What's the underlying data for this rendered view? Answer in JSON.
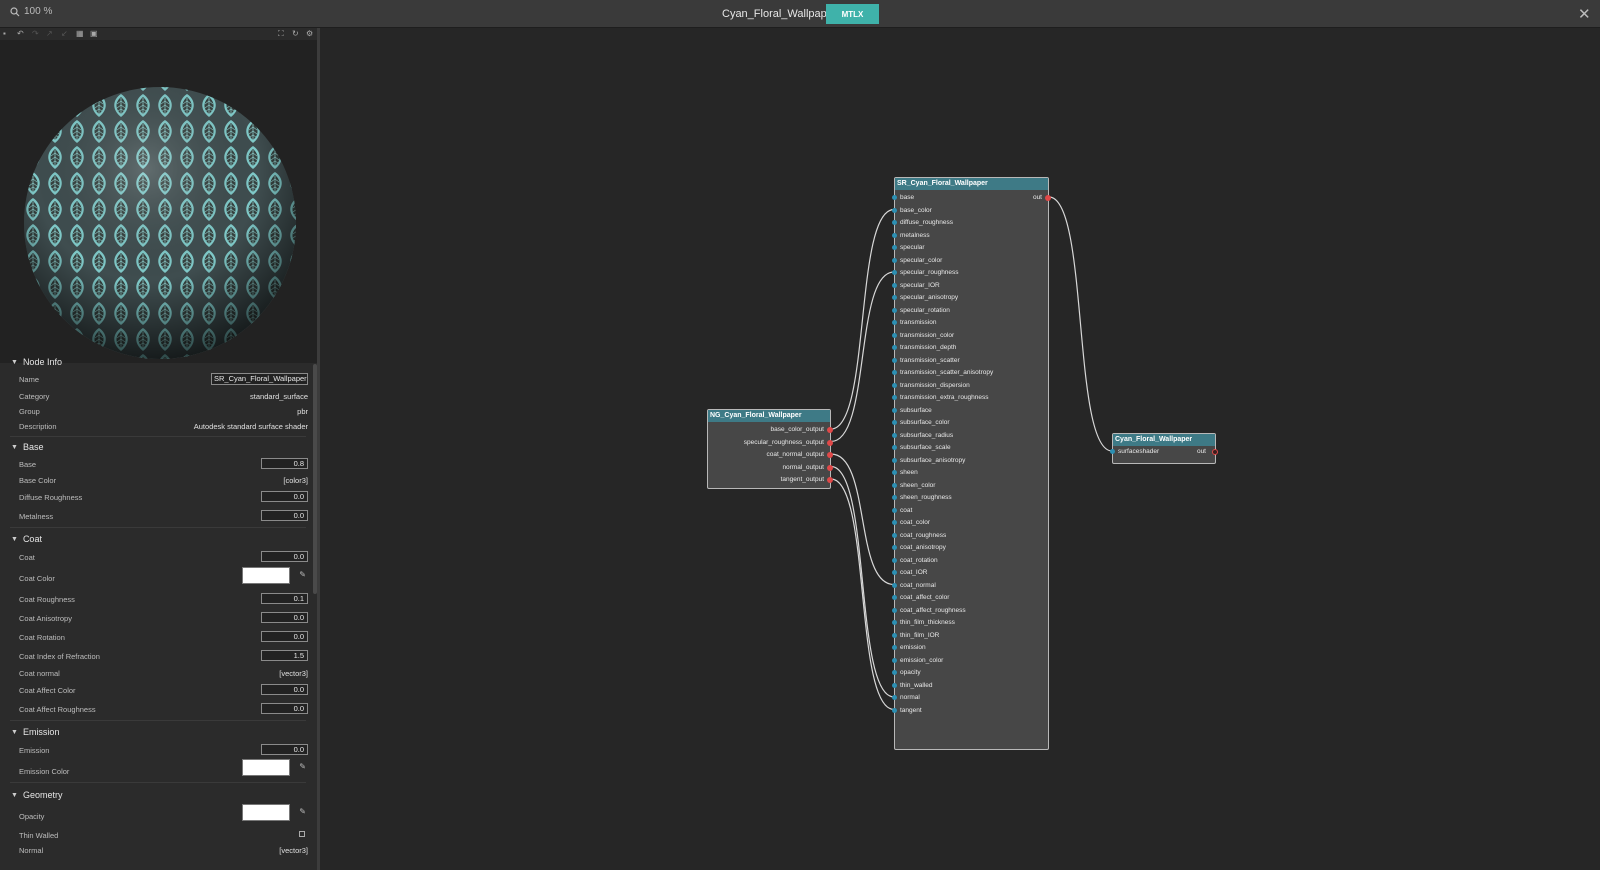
{
  "header": {
    "zoom": "100 %",
    "title": "Cyan_Floral_Wallpaper",
    "mtlx_label": "MTLX"
  },
  "toolbar": {
    "icons": [
      "save-icon",
      "undo-icon",
      "redo-icon",
      "forward-icon",
      "back-icon",
      "grid-icon",
      "layout-icon",
      "fullscreen-icon",
      "refresh-icon",
      "settings-icon"
    ]
  },
  "panel": {
    "node_info": {
      "title": "Node Info",
      "name_label": "Name",
      "name_value": "SR_Cyan_Floral_Wallpaper",
      "category_label": "Category",
      "category_value": "standard_surface",
      "group_label": "Group",
      "group_value": "pbr",
      "description_label": "Description",
      "description_value": "Autodesk standard surface shader"
    },
    "base": {
      "title": "Base",
      "base_label": "Base",
      "base_value": "0.8",
      "base_color_label": "Base Color",
      "base_color_value": "[color3]",
      "diffuse_roughness_label": "Diffuse Roughness",
      "diffuse_roughness_value": "0.0",
      "metalness_label": "Metalness",
      "metalness_value": "0.0"
    },
    "coat": {
      "title": "Coat",
      "coat_label": "Coat",
      "coat_value": "0.0",
      "coat_color_label": "Coat Color",
      "coat_roughness_label": "Coat Roughness",
      "coat_roughness_value": "0.1",
      "coat_anisotropy_label": "Coat Anisotropy",
      "coat_anisotropy_value": "0.0",
      "coat_rotation_label": "Coat Rotation",
      "coat_rotation_value": "0.0",
      "coat_ior_label": "Coat Index of Refraction",
      "coat_ior_value": "1.5",
      "coat_normal_label": "Coat normal",
      "coat_normal_value": "[vector3]",
      "coat_affect_color_label": "Coat Affect Color",
      "coat_affect_color_value": "0.0",
      "coat_affect_roughness_label": "Coat Affect Roughness",
      "coat_affect_roughness_value": "0.0"
    },
    "emission": {
      "title": "Emission",
      "emission_label": "Emission",
      "emission_value": "0.0",
      "emission_color_label": "Emission Color"
    },
    "geometry": {
      "title": "Geometry",
      "opacity_label": "Opacity",
      "thin_walled_label": "Thin Walled",
      "normal_label": "Normal",
      "normal_value": "[vector3]"
    }
  },
  "graph": {
    "ng_node": {
      "title": "NG_Cyan_Floral_Wallpaper",
      "outputs": [
        "base_color_output",
        "specular_roughness_output",
        "coat_normal_output",
        "normal_output",
        "tangent_output"
      ]
    },
    "sr_node": {
      "title": "SR_Cyan_Floral_Wallpaper",
      "out_label": "out",
      "inputs": [
        "base",
        "base_color",
        "diffuse_roughness",
        "metalness",
        "specular",
        "specular_color",
        "specular_roughness",
        "specular_IOR",
        "specular_anisotropy",
        "specular_rotation",
        "transmission",
        "transmission_color",
        "transmission_depth",
        "transmission_scatter",
        "transmission_scatter_anisotropy",
        "transmission_dispersion",
        "transmission_extra_roughness",
        "subsurface",
        "subsurface_color",
        "subsurface_radius",
        "subsurface_scale",
        "subsurface_anisotropy",
        "sheen",
        "sheen_color",
        "sheen_roughness",
        "coat",
        "coat_color",
        "coat_roughness",
        "coat_anisotropy",
        "coat_rotation",
        "coat_IOR",
        "coat_normal",
        "coat_affect_color",
        "coat_affect_roughness",
        "thin_film_thickness",
        "thin_film_IOR",
        "emission",
        "emission_color",
        "opacity",
        "thin_walled",
        "normal",
        "tangent"
      ]
    },
    "mat_node": {
      "title": "Cyan_Floral_Wallpaper",
      "input": "surfaceshader",
      "out_label": "out"
    },
    "connections": [
      {
        "from": "base_color_output",
        "to": "base_color"
      },
      {
        "from": "specular_roughness_output",
        "to": "specular_roughness"
      },
      {
        "from": "coat_normal_output",
        "to": "coat_normal"
      },
      {
        "from": "normal_output",
        "to": "normal"
      },
      {
        "from": "tangent_output",
        "to": "tangent"
      },
      {
        "from": "out",
        "to": "surfaceshader"
      }
    ]
  },
  "colors": {
    "accent": "#3fb2aa",
    "node_header": "#3e7a86",
    "input_pin": "#2c8fb2",
    "output_pin": "#e04848"
  }
}
